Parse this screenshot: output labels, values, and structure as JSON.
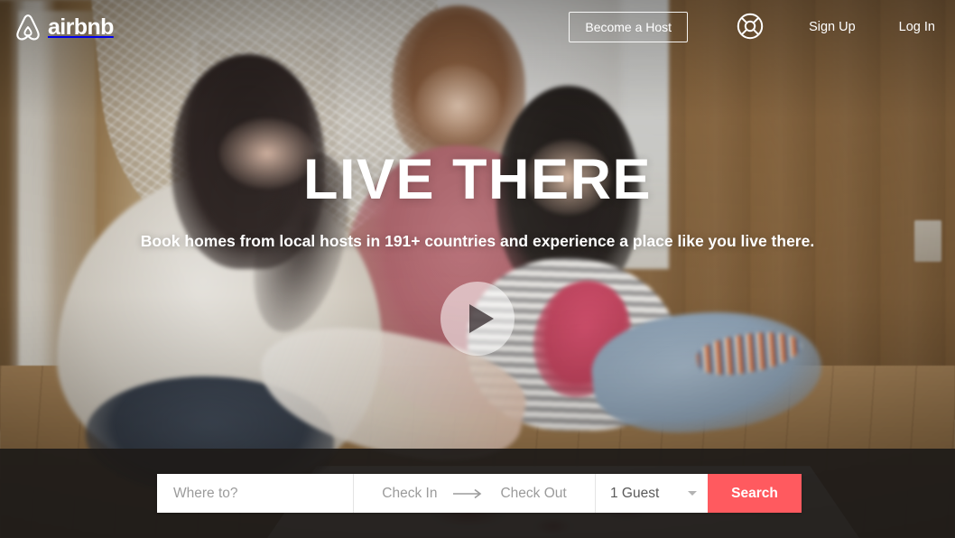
{
  "brand": {
    "name": "airbnb",
    "logo_icon": "airbnb-belo-icon",
    "accent_color": "#FF5A5F"
  },
  "header": {
    "become_host_label": "Become a Host",
    "help_icon": "lifebuoy-help-icon",
    "sign_up_label": "Sign Up",
    "log_in_label": "Log In"
  },
  "hero": {
    "title": "LIVE THERE",
    "subtitle": "Book homes from local hosts in 191+ countries and experience a place like you live there.",
    "play_icon": "play-triangle-icon",
    "play_label": "Play video"
  },
  "search": {
    "where_placeholder": "Where to?",
    "where_value": "",
    "check_in_label": "Check In",
    "date_arrow_icon": "arrow-right-icon",
    "check_out_label": "Check Out",
    "guests_value": "1 Guest",
    "guests_chevron_icon": "chevron-down-icon",
    "search_button_label": "Search"
  }
}
